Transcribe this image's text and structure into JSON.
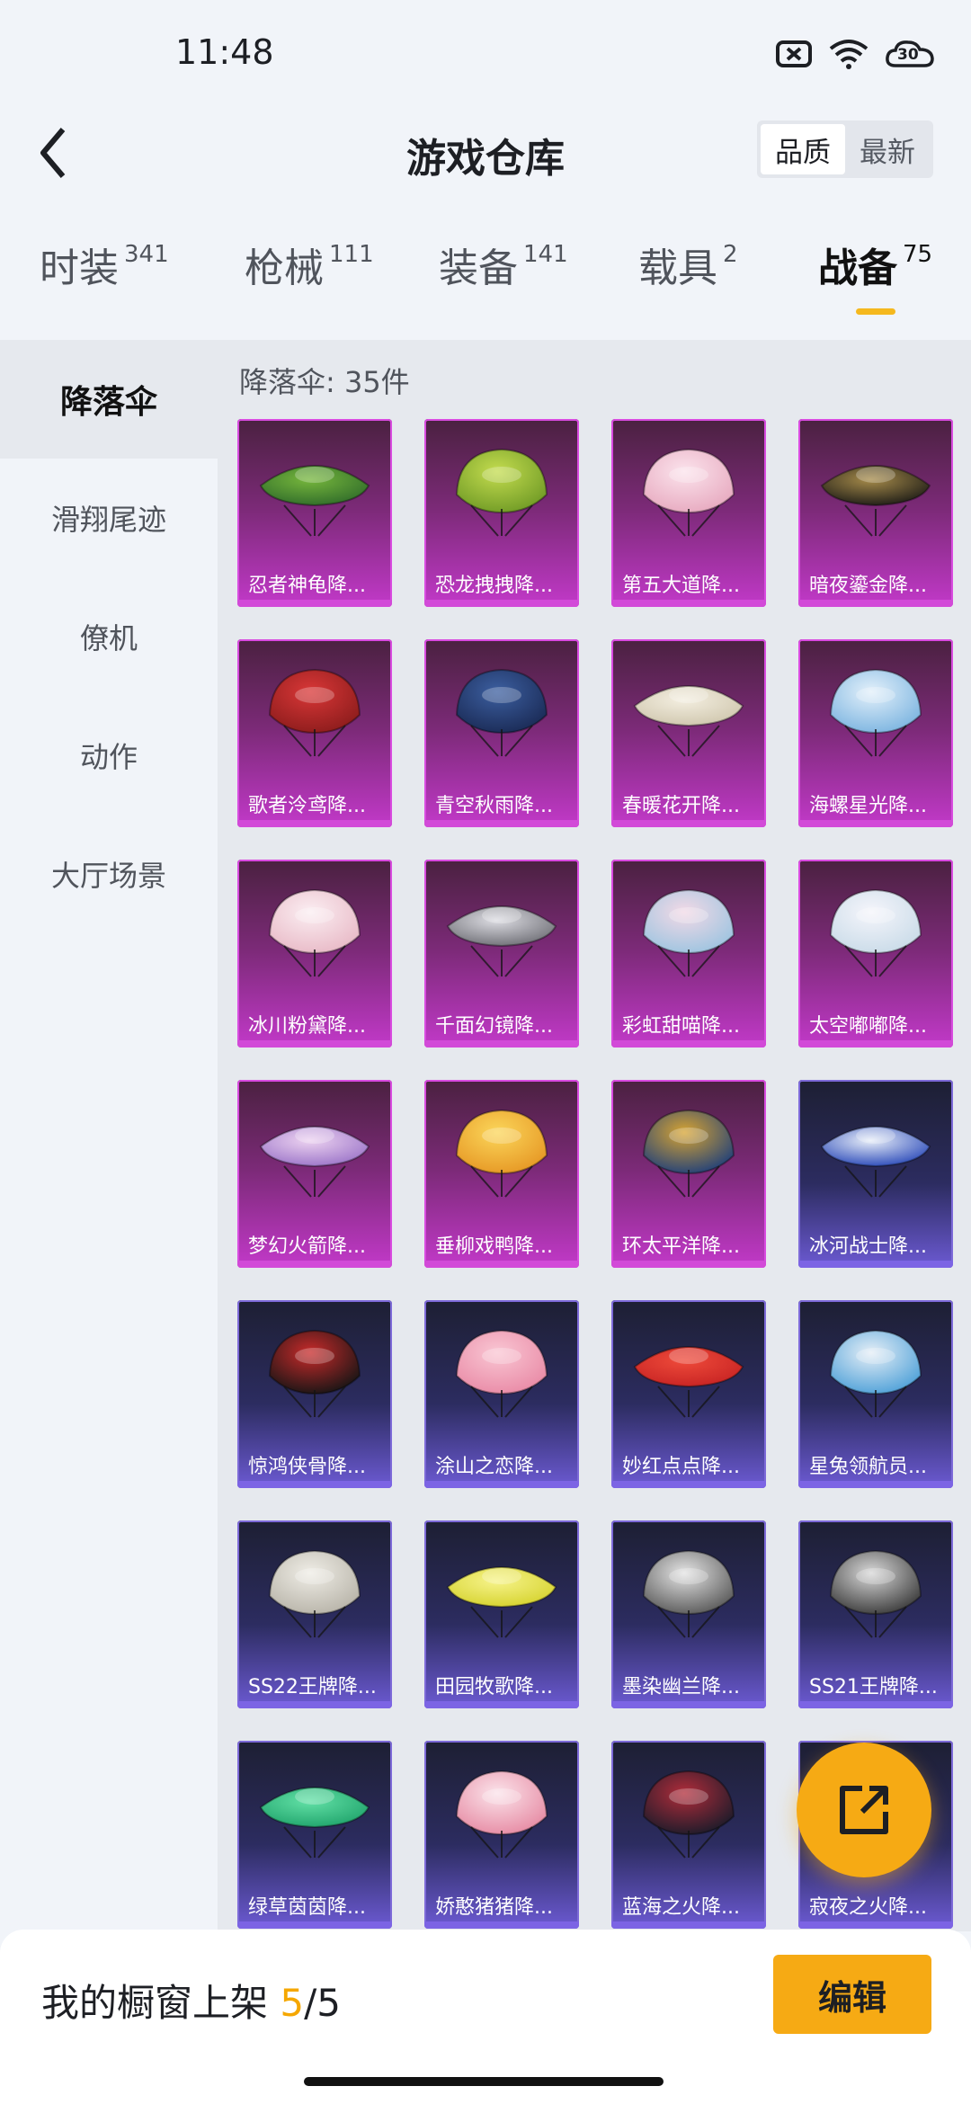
{
  "status": {
    "time": "11:48",
    "battery": "30"
  },
  "header": {
    "title": "游戏仓库",
    "sort": [
      "品质",
      "最新"
    ]
  },
  "tabs": [
    {
      "label": "时装",
      "count": "341"
    },
    {
      "label": "枪械",
      "count": "111"
    },
    {
      "label": "装备",
      "count": "141"
    },
    {
      "label": "载具",
      "count": "2"
    },
    {
      "label": "战备",
      "count": "75"
    }
  ],
  "sidebar": [
    "降落伞",
    "滑翔尾迹",
    "僚机",
    "动作",
    "大厅场景"
  ],
  "section_label": "降落伞: 35件",
  "items": [
    {
      "name": "忍者神龟降...",
      "tier": "purple",
      "c1": "#2f6b2a",
      "c2": "#76b63c"
    },
    {
      "name": "恐龙拽拽降...",
      "tier": "purple",
      "c1": "#6f9a25",
      "c2": "#c4dc4f"
    },
    {
      "name": "第五大道降...",
      "tier": "purple",
      "c1": "#e7a9bf",
      "c2": "#fbe3ec"
    },
    {
      "name": "暗夜鎏金降...",
      "tier": "purple",
      "c1": "#1b1a16",
      "c2": "#a68b4a"
    },
    {
      "name": "歌者泠鸢降...",
      "tier": "purple",
      "c1": "#8c1c1c",
      "c2": "#d93737"
    },
    {
      "name": "青空秋雨降...",
      "tier": "purple",
      "c1": "#1a2a55",
      "c2": "#3c5fa0"
    },
    {
      "name": "春暖花开降...",
      "tier": "purple",
      "c1": "#cfc6ad",
      "c2": "#f3eee0"
    },
    {
      "name": "海螺星光降...",
      "tier": "purple",
      "c1": "#7bb4e0",
      "c2": "#e3f0fa"
    },
    {
      "name": "冰川粉黛降...",
      "tier": "purple",
      "c1": "#e8b9c6",
      "c2": "#fbeef2"
    },
    {
      "name": "千面幻镜降...",
      "tier": "purple",
      "c1": "#6d6d74",
      "c2": "#dcdce2"
    },
    {
      "name": "彩虹甜喵降...",
      "tier": "purple",
      "c1": "#9cc4e0",
      "c2": "#f2d9e6"
    },
    {
      "name": "太空嘟嘟降...",
      "tier": "purple",
      "c1": "#c9dbe8",
      "c2": "#f5f5fb"
    },
    {
      "name": "梦幻火箭降...",
      "tier": "purple",
      "c1": "#9a73c8",
      "c2": "#ecd2f0"
    },
    {
      "name": "垂柳戏鸭降...",
      "tier": "purple",
      "c1": "#e69724",
      "c2": "#fbd65a"
    },
    {
      "name": "环太平洋降...",
      "tier": "purple",
      "c1": "#1f3f7a",
      "c2": "#d7a432"
    },
    {
      "name": "冰河战士降...",
      "tier": "blue",
      "c1": "#2747b8",
      "c2": "#e8eef8"
    },
    {
      "name": "惊鸿侠骨降...",
      "tier": "blue",
      "c1": "#151515",
      "c2": "#c82a2a"
    },
    {
      "name": "涂山之恋降...",
      "tier": "blue",
      "c1": "#e98aa6",
      "c2": "#f9c6d3"
    },
    {
      "name": "妙红点点降...",
      "tier": "blue",
      "c1": "#c72323",
      "c2": "#ee4a3a"
    },
    {
      "name": "星兔领航员...",
      "tier": "blue",
      "c1": "#4da0d8",
      "c2": "#e5eef6"
    },
    {
      "name": "SS22王牌降...",
      "tier": "blue",
      "c1": "#b7b3a8",
      "c2": "#efede6"
    },
    {
      "name": "田园牧歌降...",
      "tier": "blue",
      "c1": "#d5d22c",
      "c2": "#f6f38a"
    },
    {
      "name": "墨染幽兰降...",
      "tier": "blue",
      "c1": "#585858",
      "c2": "#e4e4e4"
    },
    {
      "name": "SS21王牌降...",
      "tier": "blue",
      "c1": "#3a3a3a",
      "c2": "#d8d8d8"
    },
    {
      "name": "绿草茵茵降...",
      "tier": "blue",
      "c1": "#1fa36b",
      "c2": "#62e0a6"
    },
    {
      "name": "娇憨猪猪降...",
      "tier": "blue",
      "c1": "#e68aa3",
      "c2": "#fbe3ea"
    },
    {
      "name": "蓝海之火降...",
      "tier": "blue",
      "c1": "#1a1b2a",
      "c2": "#b12c3a"
    },
    {
      "name": "寂夜之火降...",
      "tier": "blue",
      "c1": "#161622",
      "c2": "#5e2a3c"
    }
  ],
  "bottom": {
    "prefix": "我的橱窗上架 ",
    "current": "5",
    "total": "/5",
    "edit": "编辑"
  }
}
